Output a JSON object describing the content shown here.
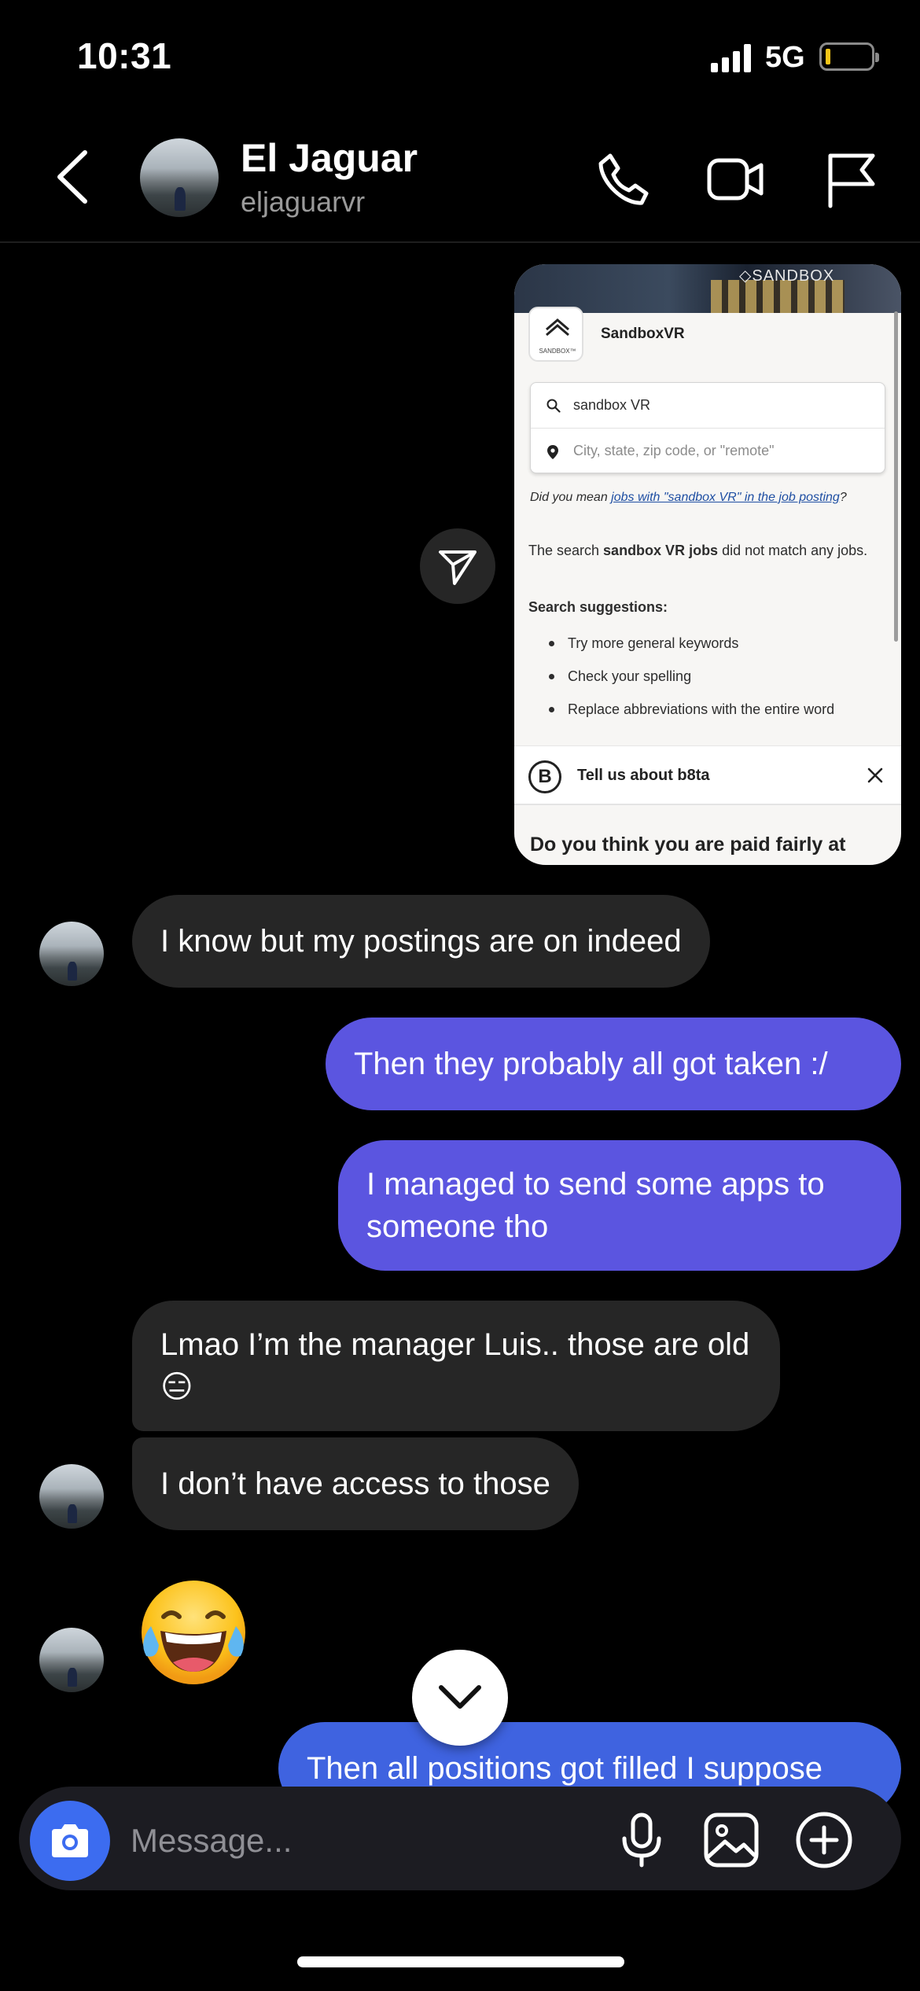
{
  "status_bar": {
    "time": "10:31",
    "network": "5G",
    "battery_level": 0.08
  },
  "header": {
    "name": "El Jaguar",
    "username": "eljaguarvr"
  },
  "shared_post": {
    "photo_brand": "◇SANDBOX",
    "company_logo_text": "SANDBOX™",
    "company_name": "SandboxVR",
    "search_query": "sandbox VR",
    "location_placeholder": "City, state, zip code, or \"remote\"",
    "did_you_mean_prefix": "Did you mean ",
    "did_you_mean_link": "jobs with \"sandbox VR\" in the job posting",
    "did_you_mean_suffix": "?",
    "no_match_prefix": "The search ",
    "no_match_query": "sandbox VR jobs",
    "no_match_suffix": " did not match any jobs.",
    "suggestions_title": "Search suggestions:",
    "suggestions": [
      "Try more general keywords",
      "Check your spelling",
      "Replace abbreviations with the entire word"
    ],
    "survey_logo": "B",
    "survey_text": "Tell us about b8ta",
    "question": "Do you think you are paid fairly at"
  },
  "messages": [
    {
      "from": "them",
      "text": "I know but my postings are on indeed"
    },
    {
      "from": "me",
      "text": "Then they probably all got taken :/"
    },
    {
      "from": "me",
      "text": "I managed to send some apps to someone tho"
    },
    {
      "from": "them",
      "text": "Lmao I’m the manager Luis.. those are old 😑"
    },
    {
      "from": "them",
      "text": "I don’t have access to those"
    },
    {
      "from": "them",
      "text": "😂"
    },
    {
      "from": "me",
      "text": "Then all positions got filled I suppose"
    }
  ],
  "composer": {
    "placeholder": "Message..."
  },
  "colors": {
    "background": "#000000",
    "received_bubble": "#262626",
    "sent_bubble": "#5b55e0",
    "camera_button": "#3c6cf0",
    "composer": "#1c1c22"
  },
  "icons": [
    "back-chevron-icon",
    "phone-icon",
    "video-icon",
    "flag-icon",
    "send-share-icon",
    "chevron-down-icon",
    "camera-icon",
    "microphone-icon",
    "gallery-icon",
    "plus-circle-icon",
    "search-icon",
    "location-pin-icon",
    "close-icon"
  ]
}
